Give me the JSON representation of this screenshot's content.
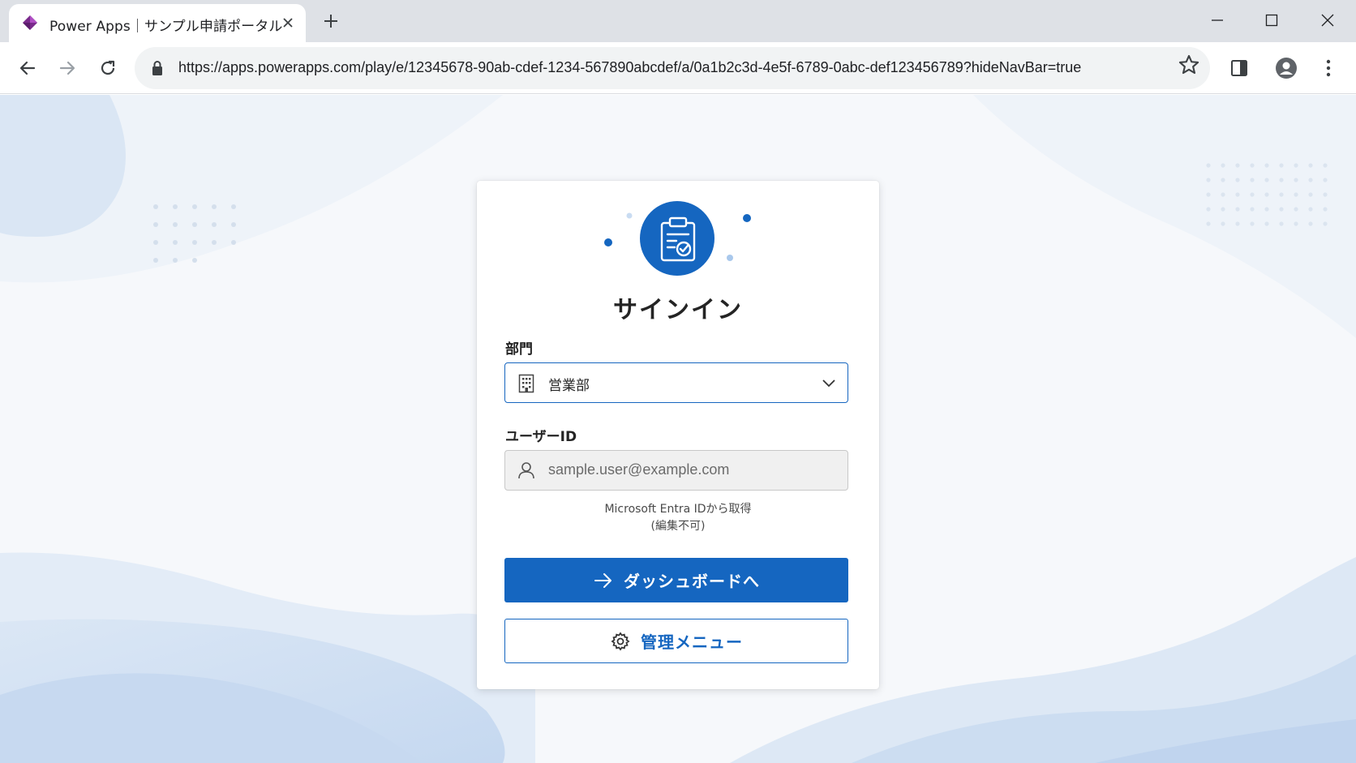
{
  "browser": {
    "tab_title": "Power Apps｜サンプル申請ポータル",
    "url": "https://apps.powerapps.com/play/e/12345678-90ab-cdef-1234-567890abcdef/a/0a1b2c3d-4e5f-6789-0abc-def123456789?hideNavBar=true",
    "icons": [
      "powerapps-favicon",
      "close-icon",
      "plus-icon",
      "minimize-icon",
      "maximize-icon",
      "close-window-icon",
      "back-arrow-icon",
      "forward-arrow-icon",
      "reload-icon",
      "lock-icon",
      "star-icon",
      "side-panel-icon",
      "profile-icon",
      "more-vert-icon"
    ]
  },
  "signin": {
    "heading": "サインイン",
    "department": {
      "label": "部門",
      "value": "営業部",
      "icon": "building-icon"
    },
    "user_id": {
      "label": "ユーザーID",
      "placeholder": "sample.user@example.com",
      "icon": "person-icon"
    },
    "hint_line1": "Microsoft Entra IDから取得",
    "hint_line2": "(編集不可)",
    "primary_button": {
      "label": "ダッシュボードへ",
      "icon": "arrow-right-icon"
    },
    "secondary_button": {
      "label": "管理メニュー",
      "icon": "gear-icon"
    }
  },
  "colors": {
    "accent": "#1566c0",
    "tabbar": "#dee1e6",
    "omnibox": "#f1f3f4"
  }
}
